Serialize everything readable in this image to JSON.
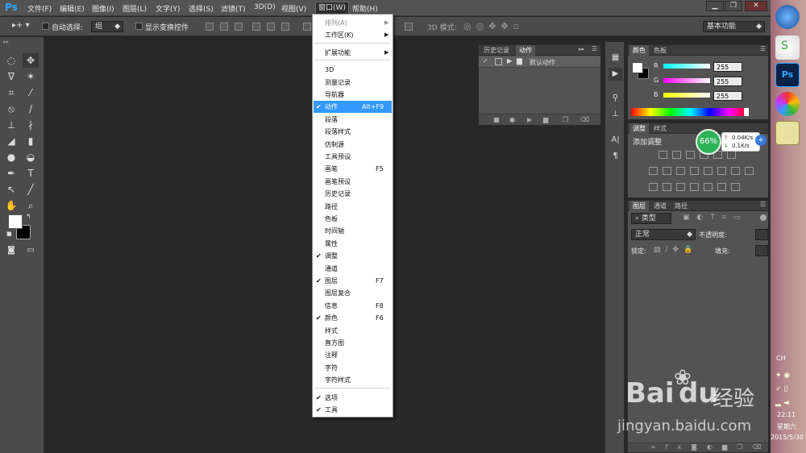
{
  "app": {
    "logo": "Ps",
    "blue": "#31a8ff"
  },
  "menubar": {
    "items": [
      "文件(F)",
      "编辑(E)",
      "图像(I)",
      "图层(L)",
      "文字(Y)",
      "选择(S)",
      "滤镜(T)",
      "3D(D)",
      "视图(V)",
      "窗口(W)",
      "帮助(H)"
    ]
  },
  "options": {
    "auto_select": "自动选择:",
    "group_value": "组",
    "show_transform": "显示变换控件",
    "mode_3d": "3D 模式:",
    "workspace": "基本功能"
  },
  "history_panel": {
    "tabs": [
      "历史记录",
      "动作"
    ],
    "row": "默认动作"
  },
  "color_panel": {
    "tabs": [
      "颜色",
      "色板"
    ],
    "r": "255",
    "g": "255",
    "b": "255",
    "r_label": "R",
    "g_label": "G",
    "b_label": "B"
  },
  "adjust_panel": {
    "tabs": [
      "调整",
      "样式"
    ],
    "title": "添加调整"
  },
  "net_widget": {
    "percent": "66%",
    "up": "0.04K/s",
    "down": "0.1K/s"
  },
  "layers_panel": {
    "tabs": [
      "图层",
      "通道",
      "路径"
    ],
    "kind": "类型",
    "blend": "正常",
    "opacity": "不透明度:",
    "lock": "锁定:",
    "fill": "填充:"
  },
  "taskbar": {
    "ime": "CH",
    "time": "22:11",
    "day": "星期六",
    "date": "2015/5/30"
  },
  "watermark": {
    "brand": "Bai",
    "brand2": "du",
    "cn": "经验",
    "url": "jingyan.baidu.com"
  },
  "window_menu": {
    "items": [
      {
        "label": "排列(A)",
        "arrow": true,
        "disabled": true
      },
      {
        "label": "工作区(K)",
        "arrow": true
      },
      {
        "label": "扩展功能",
        "arrow": true
      },
      {
        "label": "3D"
      },
      {
        "label": "测量记录"
      },
      {
        "label": "导航器"
      },
      {
        "label": "动作",
        "shortcut": "Alt+F9",
        "checked": true,
        "highlight": true
      },
      {
        "label": "段落"
      },
      {
        "label": "段落样式"
      },
      {
        "label": "仿制源"
      },
      {
        "label": "工具预设"
      },
      {
        "label": "画笔",
        "shortcut": "F5"
      },
      {
        "label": "画笔预设"
      },
      {
        "label": "历史记录"
      },
      {
        "label": "路径"
      },
      {
        "label": "色板"
      },
      {
        "label": "时间轴"
      },
      {
        "label": "属性"
      },
      {
        "label": "调整",
        "checked": true
      },
      {
        "label": "通道"
      },
      {
        "label": "图层",
        "shortcut": "F7",
        "checked": true
      },
      {
        "label": "图层复合"
      },
      {
        "label": "信息",
        "shortcut": "F8"
      },
      {
        "label": "颜色",
        "shortcut": "F6",
        "checked": true
      },
      {
        "label": "样式"
      },
      {
        "label": "直方图"
      },
      {
        "label": "注释"
      },
      {
        "label": "字符"
      },
      {
        "label": "字符样式"
      },
      {
        "label": "选项",
        "checked": true
      },
      {
        "label": "工具",
        "checked": true
      }
    ]
  }
}
